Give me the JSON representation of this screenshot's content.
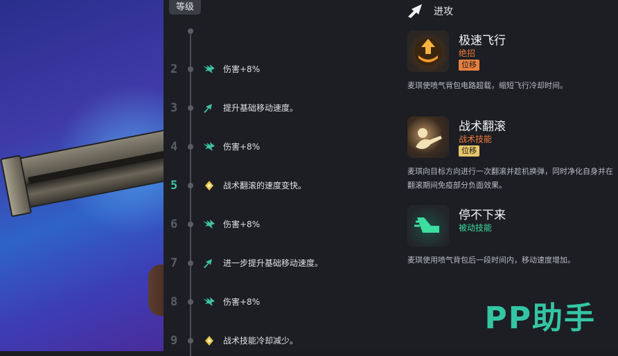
{
  "header": {
    "level_label": "等级"
  },
  "levels": [
    {
      "num": "2",
      "icon": "wing-icon",
      "text": "伤害+8%"
    },
    {
      "num": "3",
      "icon": "arrow-up-icon",
      "text": "提升基础移动速度。"
    },
    {
      "num": "4",
      "icon": "wing-icon",
      "text": "伤害+8%"
    },
    {
      "num": "5",
      "icon": "diamond-icon",
      "text": "战术翻滚的速度变快。"
    },
    {
      "num": "6",
      "icon": "wing-icon",
      "text": "伤害+8%"
    },
    {
      "num": "7",
      "icon": "arrow-up-icon",
      "text": "进一步提升基础移动速度。"
    },
    {
      "num": "8",
      "icon": "wing-icon",
      "text": "伤害+8%"
    },
    {
      "num": "9",
      "icon": "diamond-icon",
      "text": "战术技能冷却减少。"
    }
  ],
  "section": {
    "icon": "attack-arrow-icon",
    "title": "进攻"
  },
  "skills": [
    {
      "name": "极速飞行",
      "type": "绝招",
      "type_color": "#f07a3a",
      "tag": "位移",
      "tag_color": "#e8803d",
      "desc": "麦琪使喷气背包电路超载，缩短飞行冷却时间。",
      "icon": "rocket-boost-icon"
    },
    {
      "name": "战术翻滚",
      "type": "战术技能",
      "type_color": "#f07a3a",
      "tag": "位移",
      "tag_color": "#e7c66a",
      "desc": "麦琪向目标方向进行一次翻滚并趁机换弹，同时净化自身并在翻滚期间免疫部分负面效果。",
      "icon": "tactical-roll-icon"
    },
    {
      "name": "停不下来",
      "type": "被动技能",
      "type_color": "#3ddc9f",
      "tag": "",
      "tag_color": "",
      "desc": "麦琪使用喷气背包后一段时间内，移动速度增加。",
      "icon": "speed-boot-icon"
    }
  ],
  "watermark": "PP助手",
  "colors": {
    "accent_green": "#34c5a4",
    "accent_orange": "#f07a3a",
    "diamond_gold": "#e8c34a"
  }
}
